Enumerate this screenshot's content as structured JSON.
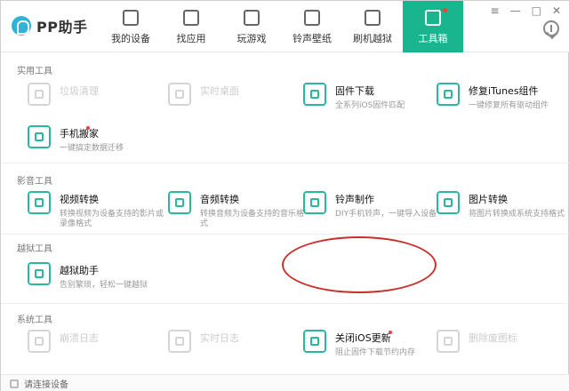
{
  "app": {
    "title": "PP助手",
    "window_controls": [
      "≡",
      "—",
      "□",
      "✕"
    ]
  },
  "nav": {
    "items": [
      {
        "label": "我的设备",
        "icon": "phone-icon",
        "active": false
      },
      {
        "label": "找应用",
        "icon": "app-store-icon",
        "active": false
      },
      {
        "label": "玩游戏",
        "icon": "gamepad-icon",
        "active": false
      },
      {
        "label": "铃声壁纸",
        "icon": "bell-wallpaper-icon",
        "active": false
      },
      {
        "label": "刷机越狱",
        "icon": "refresh-icon",
        "active": false
      },
      {
        "label": "工具箱",
        "icon": "toolbox-icon",
        "active": true,
        "dot": true
      }
    ]
  },
  "sections": {
    "practical": "实用工具",
    "media": "影音工具",
    "jailbreak": "越狱工具",
    "system": "系统工具"
  },
  "tools": {
    "clean": {
      "title": "垃圾清理",
      "desc": "",
      "enabled": false,
      "icon": "broom-icon"
    },
    "desktop": {
      "title": "实时桌面",
      "desc": "",
      "enabled": false,
      "icon": "monitor-icon"
    },
    "firmware": {
      "title": "固件下载",
      "desc": "全系列iOS固件匹配",
      "enabled": true,
      "icon": "cube-icon"
    },
    "itunes_fix": {
      "title": "修复iTunes组件",
      "desc": "一键修复所有驱动组件",
      "enabled": true,
      "icon": "wrench-icon"
    },
    "phone_move": {
      "title": "手机搬家",
      "desc": "一键搞定数据迁移",
      "enabled": true,
      "icon": "move-phone-icon",
      "dot": true
    },
    "video_convert": {
      "title": "视频转换",
      "desc": "转换视频为设备支持的影片或录像格式",
      "enabled": true,
      "icon": "film-icon"
    },
    "audio_convert": {
      "title": "音频转换",
      "desc": "转换音频为设备支持的音乐格式",
      "enabled": true,
      "icon": "music-file-icon"
    },
    "ringtone_make": {
      "title": "铃声制作",
      "desc": "DIY手机铃声，一键导入设备",
      "enabled": true,
      "icon": "bell-icon"
    },
    "image_convert": {
      "title": "图片转换",
      "desc": "将图片转换成系统支持格式",
      "enabled": true,
      "icon": "image-icon"
    },
    "jailbreak_helper": {
      "title": "越狱助手",
      "desc": "告别繁琐，轻松一键越狱",
      "enabled": true,
      "icon": "pencil-icon"
    },
    "crash_log": {
      "title": "崩溃日志",
      "desc": "",
      "enabled": false,
      "icon": "log-icon"
    },
    "realtime_log": {
      "title": "实时日志",
      "desc": "",
      "enabled": false,
      "icon": "log-live-icon"
    },
    "ios_update_off": {
      "title": "关闭iOS更新",
      "desc": "阻止固件下载节约内存",
      "enabled": true,
      "icon": "phone-lock-icon",
      "dot": true
    },
    "remove_spare_icon": {
      "title": "删除废图标",
      "desc": "",
      "enabled": false,
      "icon": "trash-icon"
    }
  },
  "status": {
    "text": "请连接设备"
  },
  "colors": {
    "accent": "#19b58f",
    "annotation": "#c9302c",
    "notification": "#ff3c3c"
  }
}
